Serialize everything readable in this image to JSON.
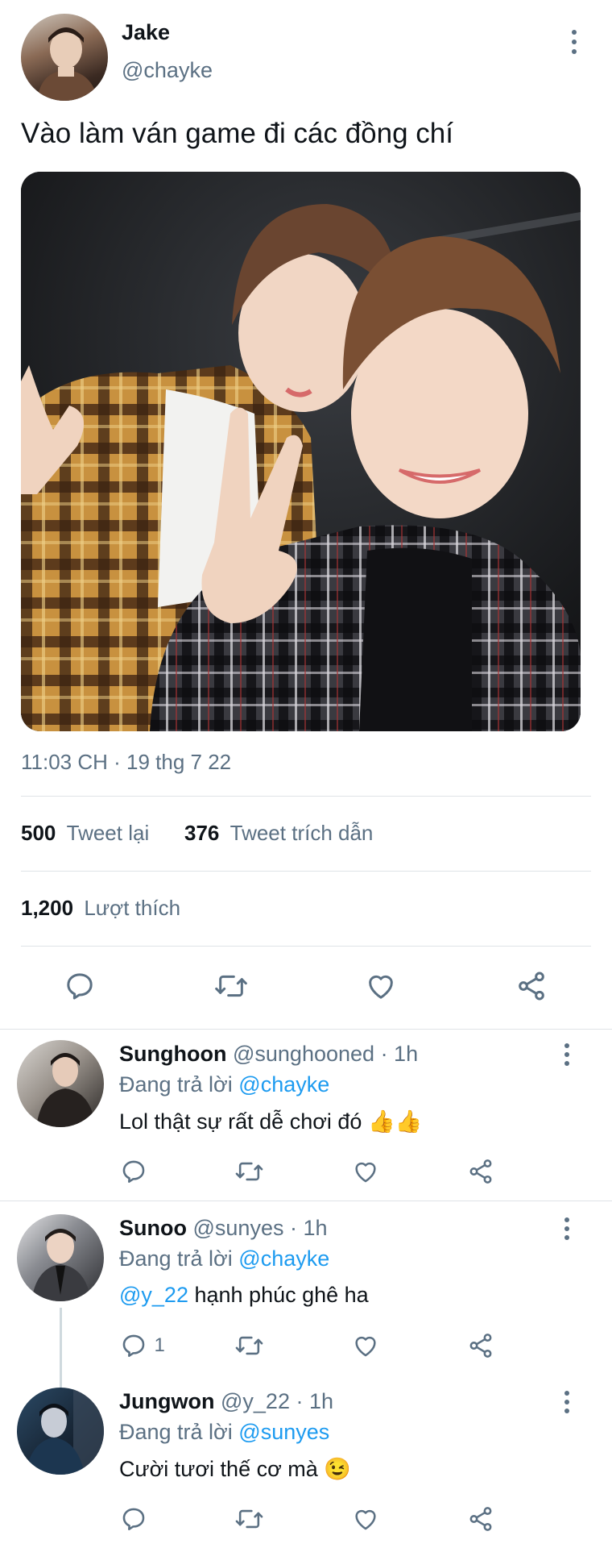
{
  "tweet": {
    "author_name": "Jake",
    "author_handle": "@chayke",
    "text": "Vào làm ván game đi các đồng chí",
    "timestamp": "11:03 CH · 19 thg 7 22",
    "retweets_count": "500",
    "retweets_label": "Tweet lại",
    "quotes_count": "376",
    "quotes_label": "Tweet trích dẫn",
    "likes_count": "1,200",
    "likes_label": "Lượt thích"
  },
  "replies": [
    {
      "name": "Sunghoon",
      "handle": "@sunghooned",
      "time": "· 1h",
      "replying_label": "Đang trả lời",
      "replying_to": "@chayke",
      "text": "Lol thật sự rất dễ chơi đó 👍👍",
      "mention": "",
      "reply_count": ""
    },
    {
      "name": "Sunoo",
      "handle": "@sunyes",
      "time": "· 1h",
      "replying_label": "Đang trả lời",
      "replying_to": "@chayke",
      "mention": "@y_22",
      "text": "hạnh phúc ghê ha",
      "reply_count": "1"
    },
    {
      "name": "Jungwon",
      "handle": "@y_22",
      "time": "· 1h",
      "replying_label": "Đang trả lời",
      "replying_to": "@sunyes",
      "text": "Cười tươi thế cơ mà 😉",
      "mention": "",
      "reply_count": ""
    }
  ],
  "icons": {
    "reply": "reply-icon",
    "retweet": "retweet-icon",
    "like": "heart-icon",
    "share": "share-icon",
    "more": "more-vertical-icon"
  },
  "colors": {
    "link": "#1d9bf0",
    "muted": "#5b7083",
    "text": "#0f1419",
    "divider": "#dfe3e7"
  }
}
